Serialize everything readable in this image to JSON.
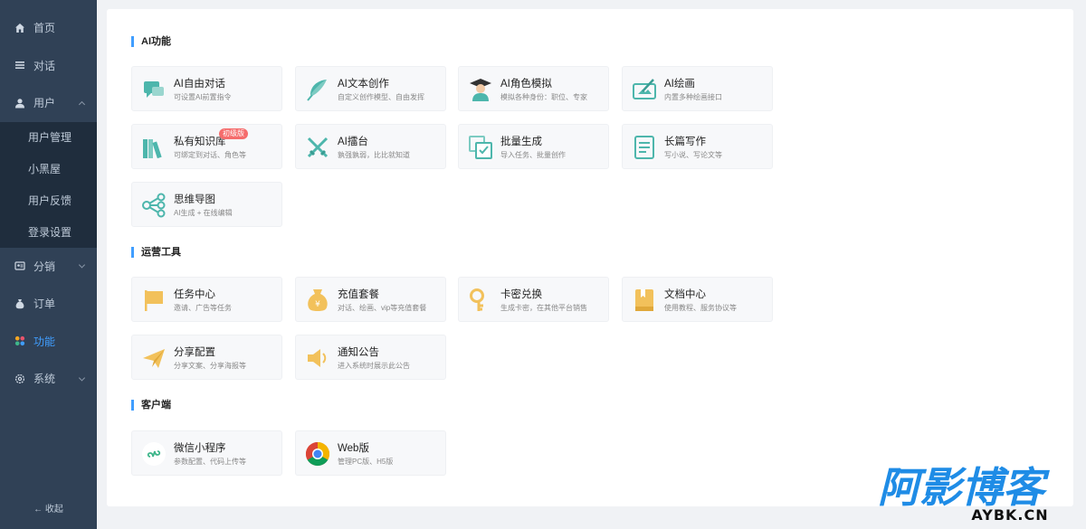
{
  "sidebar": {
    "items": [
      {
        "label": "首页",
        "icon": "home-icon"
      },
      {
        "label": "对话",
        "icon": "menu-icon"
      },
      {
        "label": "用户",
        "icon": "user-icon"
      },
      {
        "label": "分销",
        "icon": "distribution-icon"
      },
      {
        "label": "订单",
        "icon": "money-bag-icon"
      },
      {
        "label": "功能",
        "icon": "apps-icon"
      },
      {
        "label": "系统",
        "icon": "settings-icon"
      }
    ],
    "user_submenu": [
      "用户管理",
      "小黑屋",
      "用户反馈",
      "登录设置"
    ],
    "collapse_label": "收起"
  },
  "sections": [
    {
      "title": "AI功能",
      "cards": [
        {
          "title": "AI自由对话",
          "desc": "可设置AI前置指令",
          "icon": "chat-bubbles-icon"
        },
        {
          "title": "AI文本创作",
          "desc": "自定义创作模型、自由发挥",
          "icon": "feather-icon"
        },
        {
          "title": "AI角色模拟",
          "desc": "模拟各种身份：职位、专家",
          "icon": "graduate-icon"
        },
        {
          "title": "AI绘画",
          "desc": "内置多种绘画接口",
          "icon": "painting-icon"
        },
        {
          "title": "私有知识库",
          "desc": "可绑定到对话、角色等",
          "icon": "books-icon",
          "badge": "初级版"
        },
        {
          "title": "AI擂台",
          "desc": "孰强孰弱，比比就知道",
          "icon": "crossed-swords-icon"
        },
        {
          "title": "批量生成",
          "desc": "导入任务、批量创作",
          "icon": "batch-check-icon"
        },
        {
          "title": "长篇写作",
          "desc": "写小说、写论文等",
          "icon": "document-icon"
        },
        {
          "title": "思维导图",
          "desc": "AI生成 + 在线编辑",
          "icon": "mindmap-icon"
        }
      ]
    },
    {
      "title": "运营工具",
      "cards": [
        {
          "title": "任务中心",
          "desc": "邀请、广告等任务",
          "icon": "flag-icon"
        },
        {
          "title": "充值套餐",
          "desc": "对话、绘画、vip等充值套餐",
          "icon": "money-bag-icon"
        },
        {
          "title": "卡密兑换",
          "desc": "生成卡密，在其他平台销售",
          "icon": "key-icon"
        },
        {
          "title": "文档中心",
          "desc": "使用教程、服务协议等",
          "icon": "book-icon"
        },
        {
          "title": "分享配置",
          "desc": "分享文案、分享海报等",
          "icon": "paper-plane-icon"
        },
        {
          "title": "通知公告",
          "desc": "进入系统时展示此公告",
          "icon": "speaker-icon"
        }
      ]
    },
    {
      "title": "客户端",
      "cards": [
        {
          "title": "微信小程序",
          "desc": "参数配置、代码上传等",
          "icon": "miniprogram-icon"
        },
        {
          "title": "Web版",
          "desc": "管理PC版、H5版",
          "icon": "chrome-icon"
        }
      ]
    }
  ],
  "watermark": {
    "main": "阿影博客",
    "sub": "AYBK.CN"
  },
  "colors": {
    "sidebar": "#304156",
    "submenu": "#1f2d3d",
    "accent": "#409eff",
    "teal": "#4db6ac",
    "gold": "#f2c15b"
  }
}
